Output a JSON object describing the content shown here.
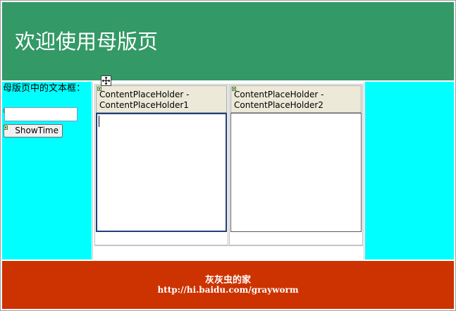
{
  "header": {
    "title": "欢迎使用母版页"
  },
  "left": {
    "label": "母版页中的文本框：",
    "textbox_value": "",
    "button_label": "ShowTime"
  },
  "placeholders": [
    {
      "title": "ContentPlaceHolder -\nContentPlaceHolder1"
    },
    {
      "title": "ContentPlaceHolder -\nContentPlaceHolder2"
    }
  ],
  "footer": {
    "line1": "灰灰虫的家",
    "line2": "http://hi.baidu.com/grayworm"
  },
  "colors": {
    "header_bg": "#339966",
    "side_bg": "#00ffff",
    "footer_bg": "#cc3300"
  },
  "icons": {
    "move_handle": "move-arrows-icon",
    "control_glyph": "control-glyph-icon"
  }
}
